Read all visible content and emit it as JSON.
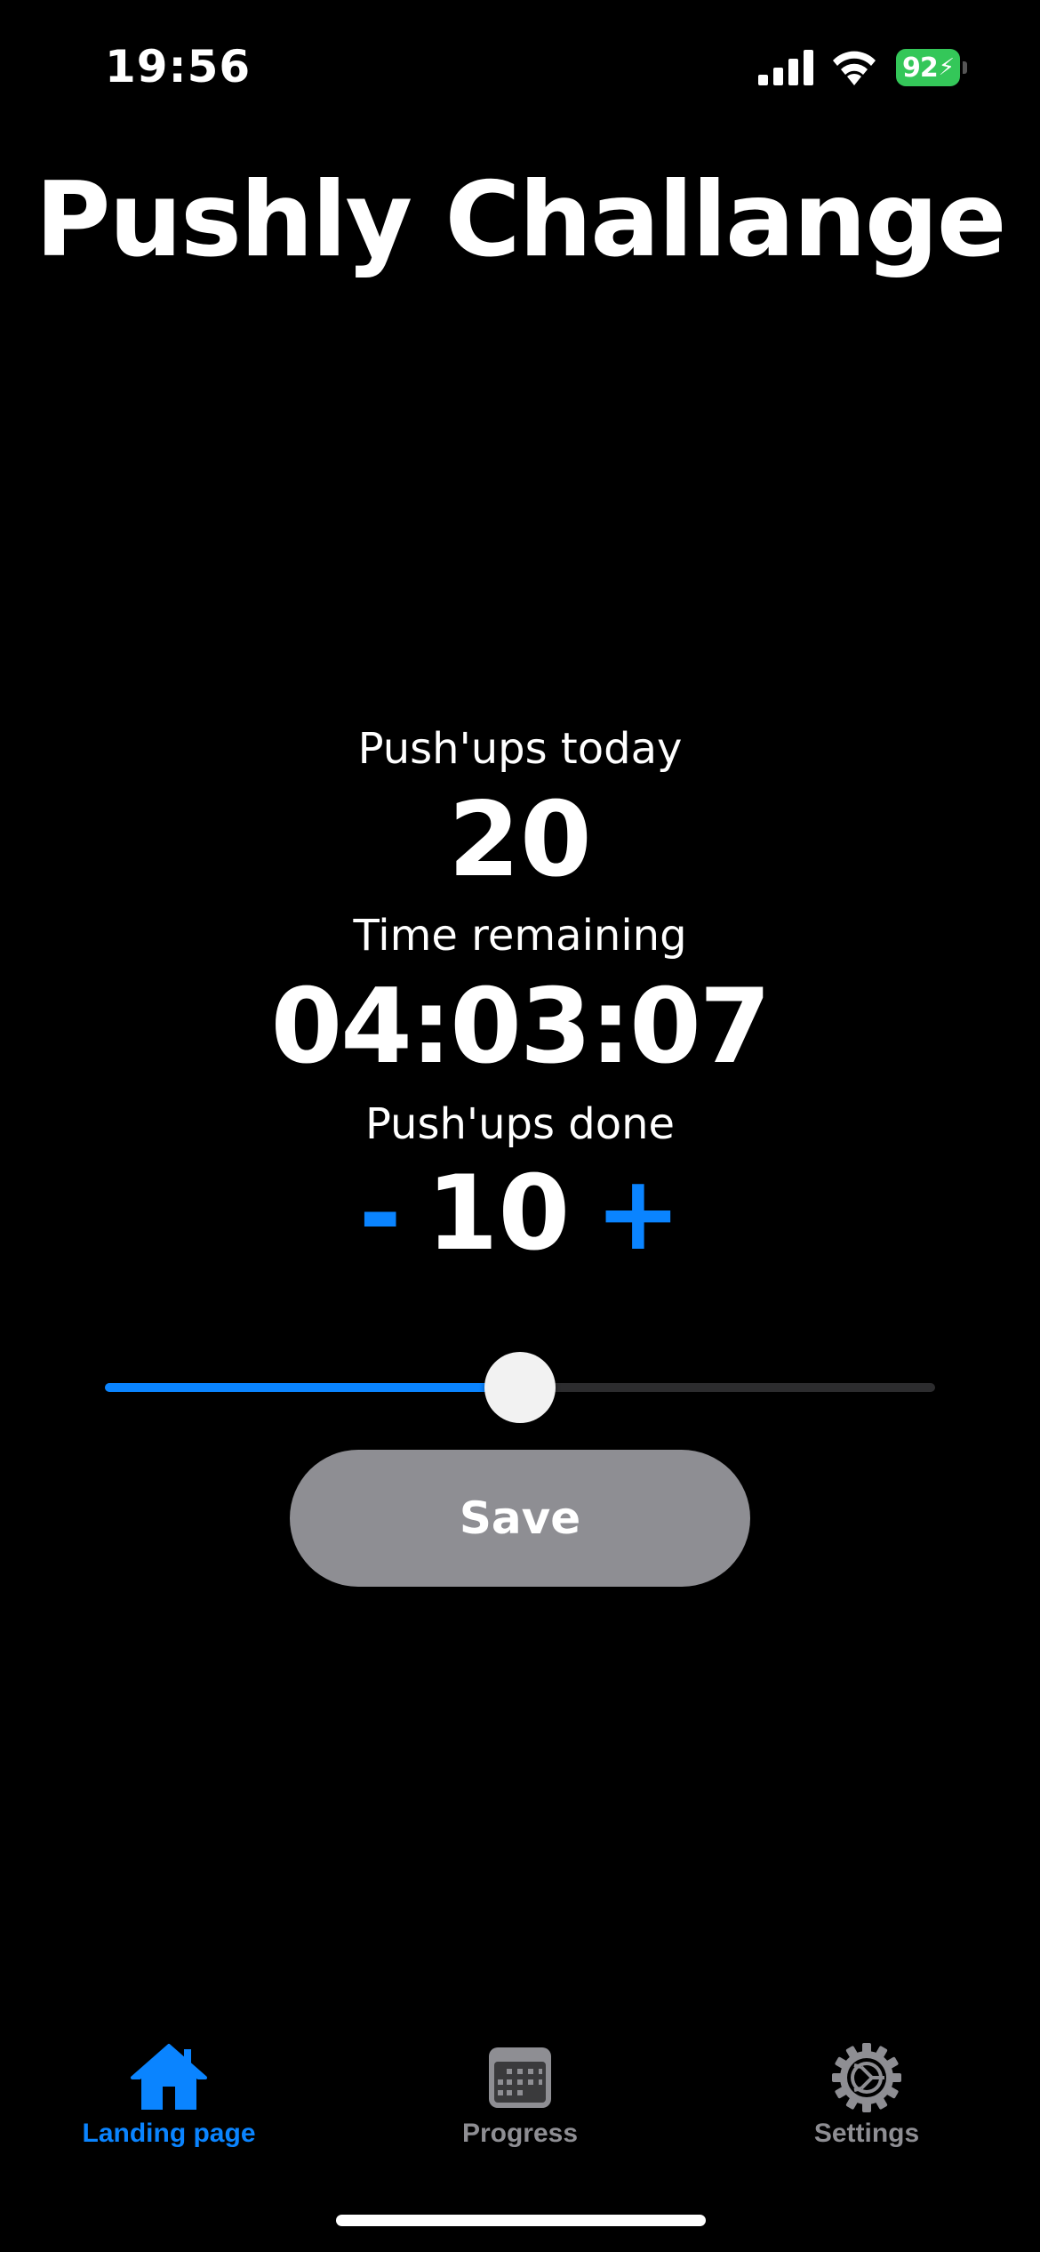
{
  "status_bar": {
    "time": "19:56",
    "battery": "92"
  },
  "app": {
    "title": "Pushly Challange"
  },
  "stats": {
    "pushups_today_label": "Push'ups today",
    "pushups_today_value": "20",
    "time_remaining_label": "Time remaining",
    "time_remaining_value": "04:03:07",
    "pushups_done_label": "Push'ups done",
    "pushups_done_value": "10",
    "minus_symbol": "-",
    "plus_symbol": "+"
  },
  "slider": {
    "value": 10,
    "min": 0,
    "max": 20
  },
  "save_button": {
    "label": "Save"
  },
  "tab_bar": {
    "items": [
      {
        "label": "Landing page",
        "icon": "house-icon",
        "active": true
      },
      {
        "label": "Progress",
        "icon": "calendar-icon",
        "active": false
      },
      {
        "label": "Settings",
        "icon": "gear-icon",
        "active": false
      }
    ]
  },
  "colors": {
    "accent": "#0a84ff",
    "background": "#000000",
    "button_gray": "#8e8e93",
    "battery_green": "#34c759",
    "inactive_gray": "#8e8e93"
  }
}
